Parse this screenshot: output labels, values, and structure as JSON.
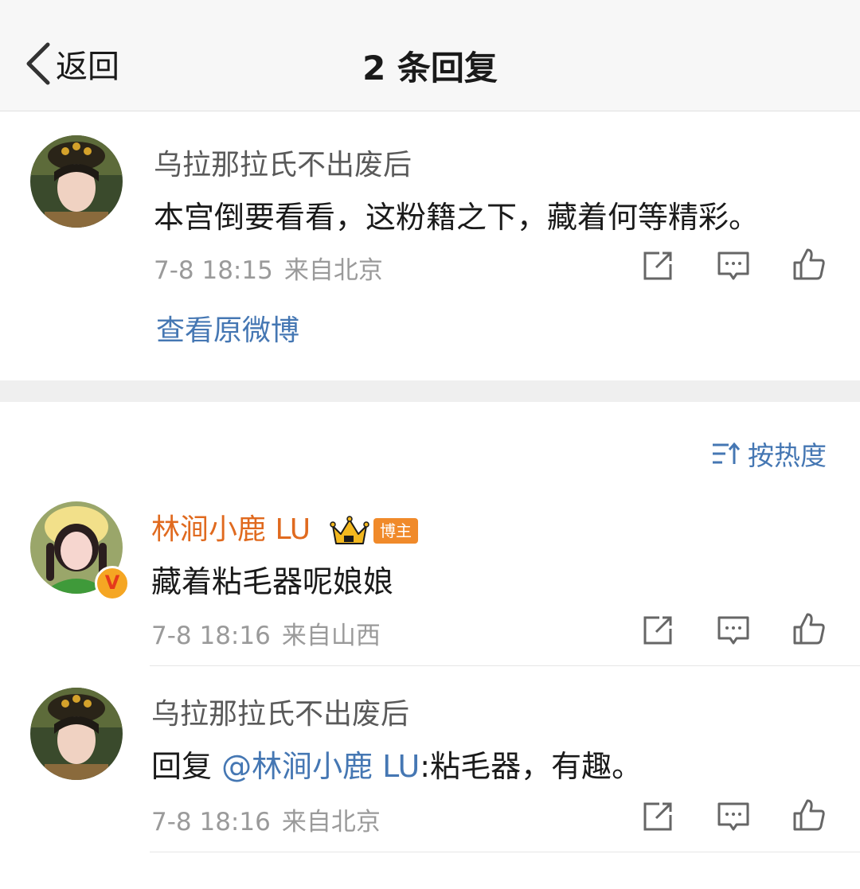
{
  "nav": {
    "back_label": "返回",
    "title": "2 条回复"
  },
  "root_comment": {
    "username": "乌拉那拉氏不出废后",
    "text": "本宫倒要看看，这粉籍之下，藏着何等精彩。",
    "time": "7-8 18:15",
    "location": "来自北京",
    "view_original": "查看原微博"
  },
  "sort": {
    "label": "按热度",
    "icon": "sort-icon"
  },
  "replies": [
    {
      "username": "林涧小鹿 LU",
      "badge": "博主",
      "text": "藏着粘毛器呢娘娘",
      "time": "7-8 18:16",
      "location": "来自山西"
    },
    {
      "username": "乌拉那拉氏不出废后",
      "reply_prefix": "回复 ",
      "mention": "@林涧小鹿 LU",
      "reply_text": ":粘毛器，有趣。",
      "time": "7-8 18:16",
      "location": "来自北京"
    }
  ],
  "icons": {
    "share": "share-icon",
    "comment": "comment-icon",
    "like": "like-icon",
    "verified": "V"
  },
  "colors": {
    "link": "#4577b3",
    "vip_name": "#e06a1f",
    "badge": "#f08a2a"
  }
}
